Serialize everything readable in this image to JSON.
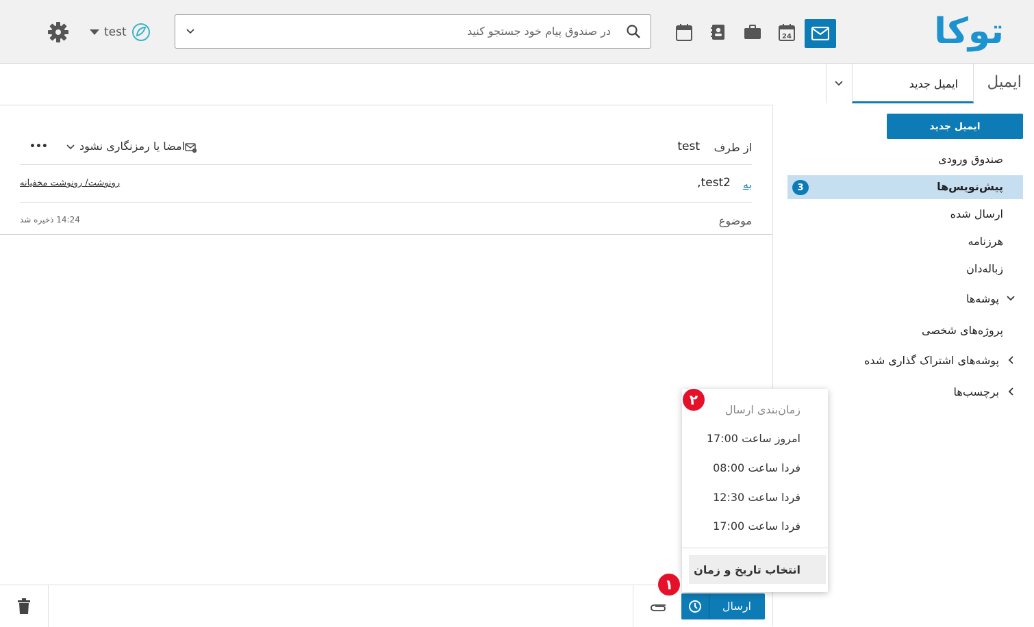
{
  "app": {
    "logo": "توکا",
    "search_placeholder": "در صندوق پیام خود جستجو کنید",
    "user_name": "test",
    "accent_color": "#0d7bb5",
    "app_icons": [
      "mail-icon",
      "calendar-24-icon",
      "briefcase-icon",
      "contacts-icon",
      "calendar-icon"
    ]
  },
  "tabs": {
    "section": "ایمیل",
    "active_tab": "ایمیل جدید"
  },
  "sidebar": {
    "new_email_button": "ایمیل جدید",
    "items": [
      {
        "label": "صندوق ورودی"
      },
      {
        "label": "پیش‌نویس‌ها",
        "badge": "3",
        "selected": true
      },
      {
        "label": "ارسال شده"
      },
      {
        "label": "هرزنامه"
      },
      {
        "label": "زباله‌دان"
      },
      {
        "label": "پوشه‌ها",
        "expanded": true
      },
      {
        "label": "پروژه‌های شخصی"
      },
      {
        "label": "پوشه‌های اشتراک گذاری شده",
        "expanded": false
      },
      {
        "label": "برچسب‌ها",
        "expanded": false
      }
    ]
  },
  "compose": {
    "from_label": "از طرف",
    "from_value": "test",
    "to_label": "به",
    "to_value": "test2,",
    "subject_label": "موضوع",
    "signature_option": "امضا یا رمزنگاری نشود",
    "cc_bcc_link": "رونوشت/ رونوشت مخفیانه",
    "saved_status": "14:24 ذخیره شد",
    "more_label": "•••"
  },
  "footer": {
    "send_button": "ارسال"
  },
  "schedule_menu": {
    "title": "زمان‌بندی ارسال",
    "options": [
      "امروز ساعت 17:00",
      "فردا ساعت 08:00",
      "فردا ساعت 12:30",
      "فردا ساعت 17:00"
    ],
    "custom_option": "انتخاب تاریخ و زمان"
  },
  "annotations": {
    "marker_1": "۱",
    "marker_2": "۲",
    "marker_color": "#e5112a"
  }
}
